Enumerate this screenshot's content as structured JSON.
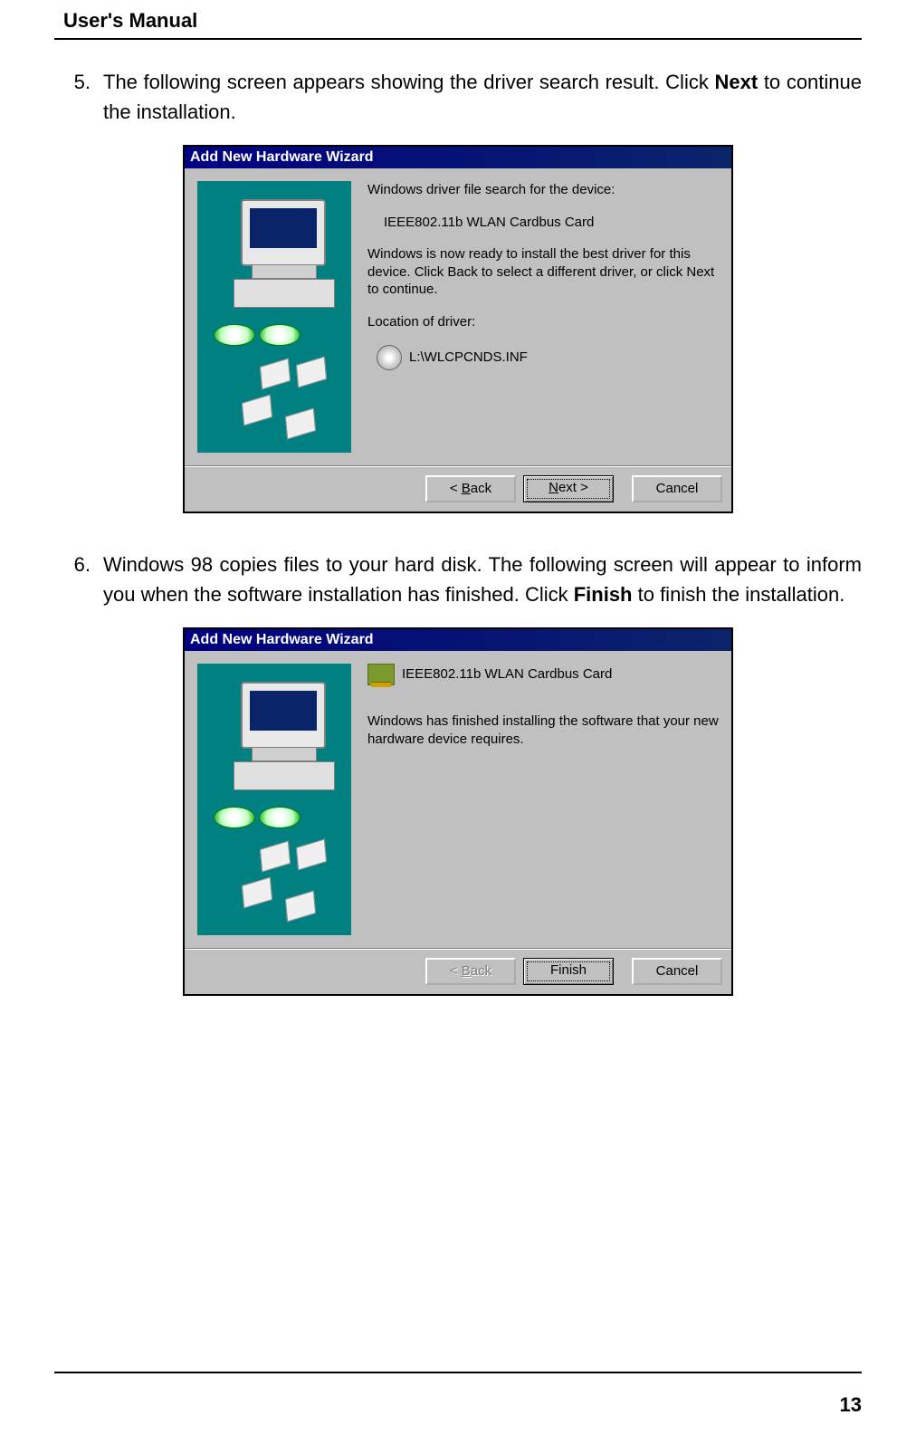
{
  "header": {
    "title": "User's Manual"
  },
  "page_number": "13",
  "steps": {
    "five": {
      "num": "5.",
      "text_a": "The following screen appears showing the driver search result. Click ",
      "bold": "Next",
      "text_b": " to continue the installation."
    },
    "six": {
      "num": "6.",
      "text_a": "Windows 98 copies files to your hard disk. The following screen will appear to inform you when the software installation has finished. Click ",
      "bold": "Finish",
      "text_b": " to finish the installation."
    }
  },
  "wizard1": {
    "title": "Add New Hardware Wizard",
    "line1": "Windows driver file search for the device:",
    "device": "IEEE802.11b WLAN Cardbus Card",
    "line2": "Windows is now ready to install the best driver for this device. Click Back to select a different driver, or click Next to continue.",
    "loc_label": "Location of driver:",
    "loc_value": "L:\\WLCPCNDS.INF",
    "back_u": "B",
    "back_rest": "ack",
    "next_u": "N",
    "next_rest": "ext >",
    "cancel": "Cancel"
  },
  "wizard2": {
    "title": "Add New Hardware Wizard",
    "device": "IEEE802.11b WLAN Cardbus Card",
    "line2": "Windows has finished installing the software that your new hardware device requires.",
    "back_u": "B",
    "back_rest": "ack",
    "finish": "Finish",
    "cancel": "Cancel"
  }
}
